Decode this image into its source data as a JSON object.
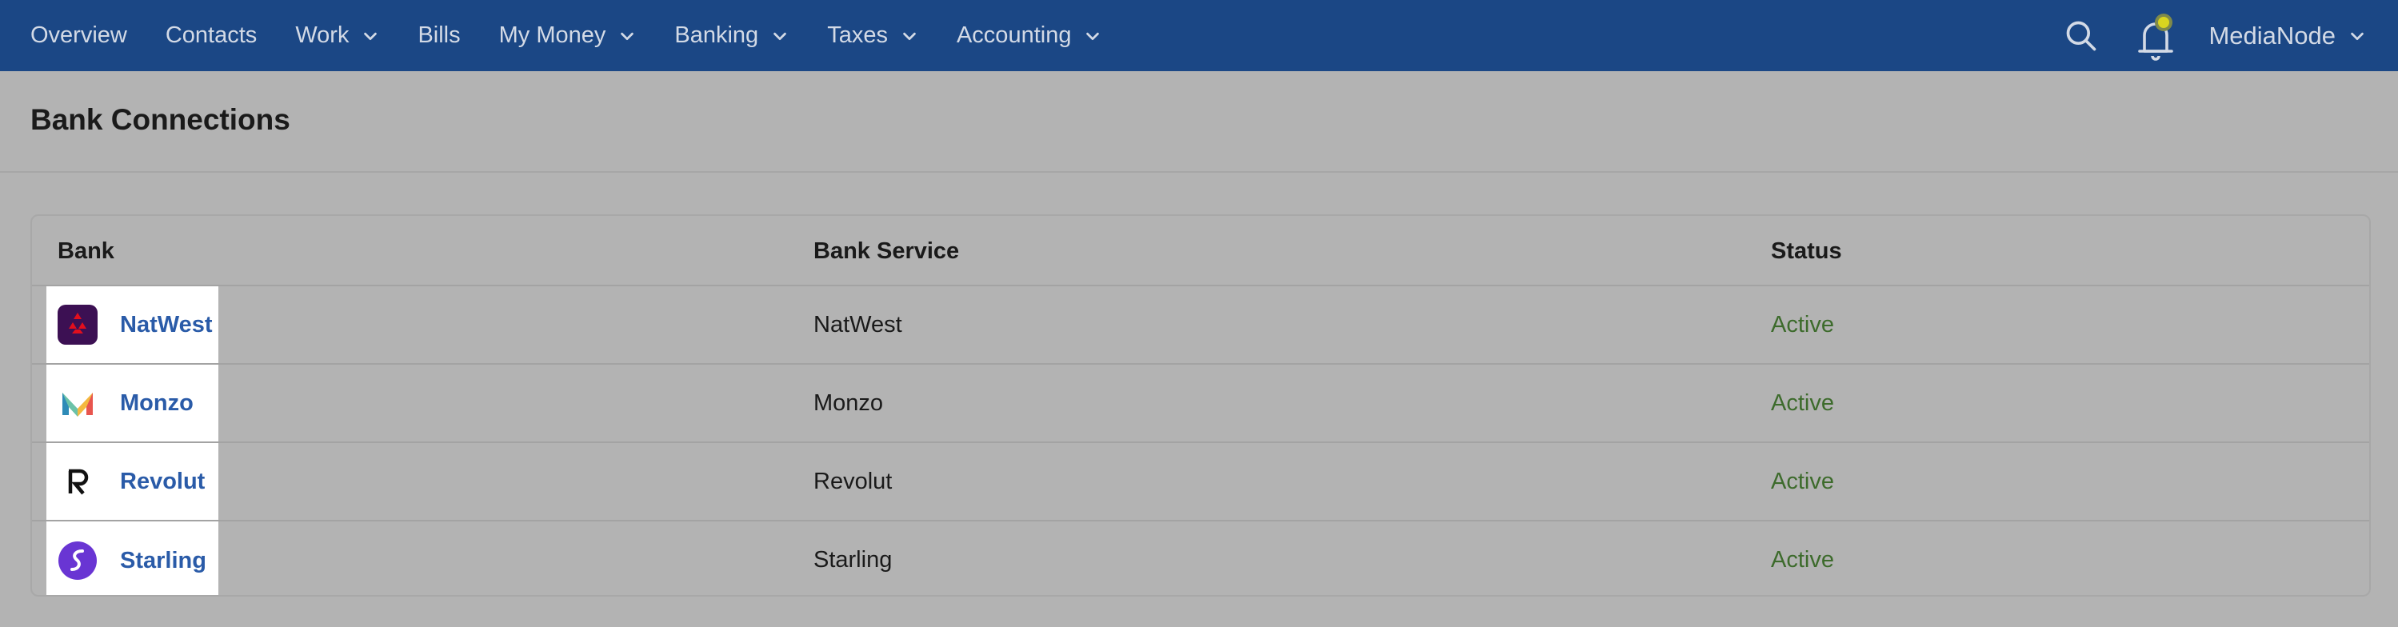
{
  "nav": {
    "items": [
      {
        "label": "Overview",
        "dropdown": false
      },
      {
        "label": "Contacts",
        "dropdown": false
      },
      {
        "label": "Work",
        "dropdown": true
      },
      {
        "label": "Bills",
        "dropdown": false
      },
      {
        "label": "My Money",
        "dropdown": true
      },
      {
        "label": "Banking",
        "dropdown": true
      },
      {
        "label": "Taxes",
        "dropdown": true
      },
      {
        "label": "Accounting",
        "dropdown": true
      }
    ],
    "user": "MediaNode"
  },
  "page": {
    "title": "Bank Connections"
  },
  "table": {
    "columns": [
      "Bank",
      "Bank Service",
      "Status"
    ],
    "rows": [
      {
        "bank": "NatWest",
        "service": "NatWest",
        "status": "Active",
        "logo": "natwest-logo"
      },
      {
        "bank": "Monzo",
        "service": "Monzo",
        "status": "Active",
        "logo": "monzo-logo"
      },
      {
        "bank": "Revolut",
        "service": "Revolut",
        "status": "Active",
        "logo": "revolut-logo"
      },
      {
        "bank": "Starling",
        "service": "Starling",
        "status": "Active",
        "logo": "starling-logo"
      }
    ]
  },
  "colors": {
    "nav_bg": "#1b4785",
    "link": "#2a5ba8",
    "status_active": "#3d6b2c",
    "notification_dot": "#d9d51f"
  }
}
